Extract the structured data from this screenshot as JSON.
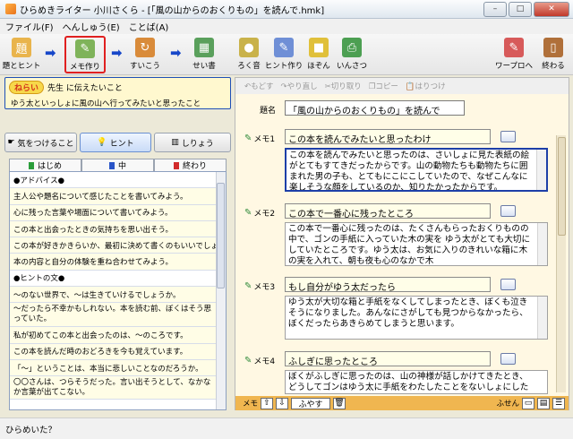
{
  "window": {
    "title": "ひらめきライター 小川さくら - [「風の山からのおくりもの」を読んで.hmk]"
  },
  "menu": [
    "ファイル(F)",
    "へんしゅう(E)",
    "ことば(A)"
  ],
  "toolbar": {
    "items": [
      {
        "label": "題とヒント",
        "icon": "title-hint-icon"
      },
      {
        "label": "メモ作り",
        "icon": "memo-create-icon",
        "selected": true
      },
      {
        "label": "すいこう",
        "icon": "revise-icon"
      },
      {
        "label": "せい書",
        "icon": "clean-copy-icon"
      },
      {
        "label": "ろく音",
        "icon": "record-icon"
      },
      {
        "label": "ヒント作り",
        "icon": "hint-create-icon"
      },
      {
        "label": "ほぞん",
        "icon": "save-icon"
      },
      {
        "label": "いんさつ",
        "icon": "print-icon"
      },
      {
        "label": "ワープロへ",
        "icon": "word-processor-icon"
      },
      {
        "label": "終わる",
        "icon": "exit-icon"
      }
    ]
  },
  "goal": {
    "badge": "ねらい",
    "heading": "先生 に伝えたいこと",
    "text": "ゆう太といっしょに風の山へ行ってみたいと思ったこと"
  },
  "category_buttons": [
    "気をつけること",
    "ヒント",
    "しりょう"
  ],
  "tabs": [
    "はじめ",
    "中",
    "終わり"
  ],
  "hint_list": [
    "●アドバイス●",
    "主人公や題名について感じたことを書いてみよう。",
    "心に残った言葉や場面について書いてみよう。",
    "この本と出会ったときの気持ちを思い出そう。",
    "この本が好きかきらいか、最初に決めて書くのもいいでしょう。",
    "本の内容と自分の体験を重ね合わせてみよう。",
    "●ヒントの文●",
    "～のない世界で、～は生きていけるでしょうか。",
    "～だったら不幸かもしれない。本を読む前、ぼくはそう思っていた。",
    "私が初めてこの本と出会ったのは、～のころです。",
    "この本を読んだ時のおどろきを今も覚えています。",
    "「～」ということは、本当に悲しいことなのだろうか。",
    "〇〇さんは、つらそうだった。言い出そうとして、なかなか言葉が出てこない。"
  ],
  "edit_toolbar": [
    "もどす",
    "やり直し",
    "切り取り",
    "コピー",
    "はりつけ"
  ],
  "title_label": "題名",
  "title_value": "「風の山からのおくりもの」を読んで",
  "memos": [
    {
      "label": "メモ1",
      "title": "この本を読んでみたいと思ったわけ",
      "body": "この本を読んでみたいと思ったのは、さいしょに見た表紙の絵がとてもすてきだったからです。山の動物たちも動物たちに囲まれた男の子も、とてもにこにこしていたので、なぜこんなに楽しそうな顔をしているのか、知りたかったからです。"
    },
    {
      "label": "メモ2",
      "title": "この本で一番心に残ったところ",
      "body": "この本で一番心に残ったのは、たくさんもらったおくりものの中で、ゴンの手紙に入っていた木の実を ゆう太がとても大切にしていたところです。ゆう太は、お気に入りのきれいな箱に木の実を入れて、朝も夜も心のなかで木"
    },
    {
      "label": "メモ3",
      "title": "もし自分がゆう太だったら",
      "body": "ゆう太が大切な箱と手紙をなくしてしまったとき、ぼくも泣きそうになりました。あんなにさがしても見つからなかったら、ぼくだったらあきらめてしまうと思います。"
    },
    {
      "label": "メモ4",
      "title": "ふしぎに思ったところ",
      "body": "ぼくがふしぎに思ったのは、山の神様が話しかけてきたとき、どうしてゴンはゆう太に手紙をわたしたことをないしょにしたのかということです。"
    }
  ],
  "memo_toolbar": {
    "label": "メモ",
    "delete_label": "ふやす",
    "fusen_label": "ふせん"
  },
  "status": "ひらめいた？"
}
